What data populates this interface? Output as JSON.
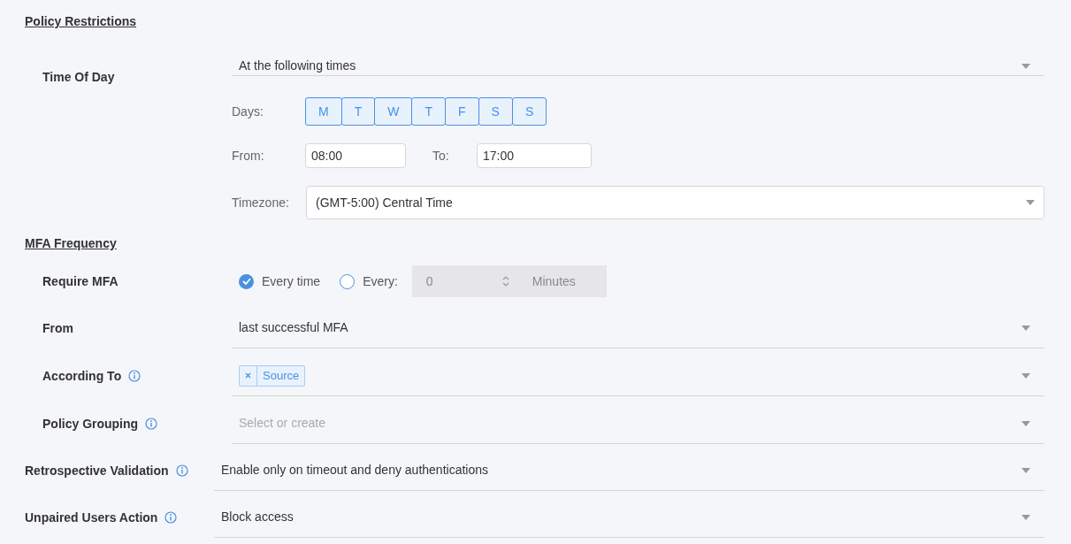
{
  "sections": [
    {
      "title": "Policy Restrictions",
      "time_of_day": {
        "label": "Time Of Day",
        "value": "At the following times",
        "days_label": "Days:",
        "days": [
          {
            "label": "M",
            "selected": true
          },
          {
            "label": "T",
            "selected": true
          },
          {
            "label": "W",
            "selected": true
          },
          {
            "label": "T",
            "selected": true
          },
          {
            "label": "F",
            "selected": true
          },
          {
            "label": "S",
            "selected": true
          },
          {
            "label": "S",
            "selected": true
          }
        ],
        "from_label": "From:",
        "from": "08:00",
        "to_label": "To:",
        "to": "17:00",
        "timezone_label": "Timezone:",
        "timezone": "(GMT-5:00) Central Time"
      }
    },
    {
      "title": "MFA Frequency",
      "require": {
        "label": "Require MFA",
        "options": [
          {
            "label": "Every time",
            "selected": true
          },
          {
            "label": "Every:",
            "selected": false
          }
        ],
        "interval": {
          "value": "0",
          "unit": "Minutes",
          "disabled": true
        }
      },
      "fields": [
        {
          "label": "From",
          "info": false,
          "kind": "select",
          "value": "last successful MFA"
        },
        {
          "label": "According To",
          "info": true,
          "kind": "tags",
          "tags": [
            "Source"
          ]
        },
        {
          "label": "Policy Grouping",
          "info": true,
          "kind": "select",
          "placeholder": "Select or create"
        }
      ]
    }
  ],
  "settings": [
    {
      "label": "Retrospective Validation",
      "info": true,
      "value": "Enable only on timeout and deny authentications"
    },
    {
      "label": "Unpaired Users Action",
      "info": true,
      "value": "Block access"
    }
  ]
}
